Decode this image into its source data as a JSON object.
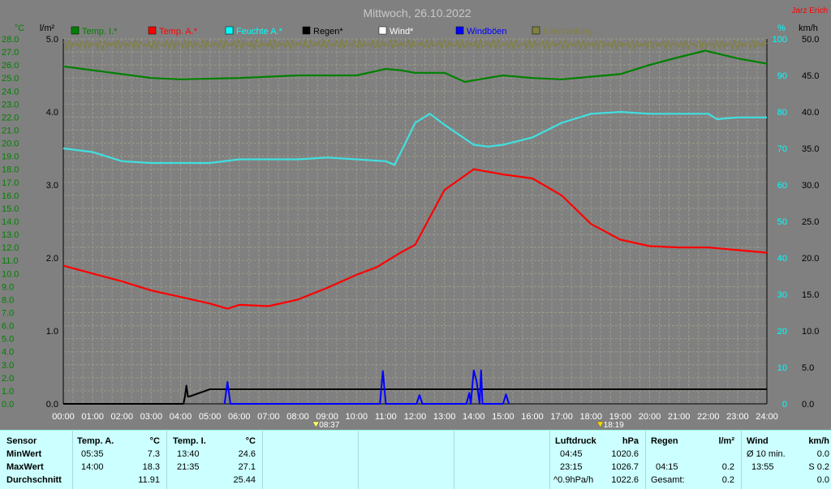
{
  "title": "Mittwoch, 26.10.2022",
  "author": "Jarz Erich",
  "axes": {
    "left_temp_unit": "°C",
    "left_rain_unit": "l/m²",
    "right_hum_unit": "%",
    "right_wind_unit": "km/h",
    "temp_ticks": [
      "28.0",
      "27.0",
      "26.0",
      "25.0",
      "24.0",
      "23.0",
      "22.0",
      "21.0",
      "20.0",
      "19.0",
      "18.0",
      "17.0",
      "16.0",
      "15.0",
      "14.0",
      "13.0",
      "12.0",
      "11.0",
      "10.0",
      "9.0",
      "8.0",
      "7.0",
      "6.0",
      "5.0",
      "4.0",
      "3.0",
      "2.0",
      "1.0",
      "0.0"
    ],
    "rain_ticks": [
      "5.0",
      "4.0",
      "3.0",
      "2.0",
      "1.0",
      "0.0"
    ],
    "hum_ticks": [
      "100",
      "90",
      "80",
      "70",
      "60",
      "50",
      "40",
      "30",
      "20",
      "10",
      "0"
    ],
    "wind_ticks": [
      "50.0",
      "45.0",
      "40.0",
      "35.0",
      "30.0",
      "25.0",
      "20.0",
      "15.0",
      "10.0",
      "5.0",
      "0.0"
    ],
    "time_ticks": [
      "00:00",
      "01:00",
      "02:00",
      "03:00",
      "04:00",
      "05:00",
      "06:00",
      "07:00",
      "08:00",
      "09:00",
      "10:00",
      "11:00",
      "12:00",
      "13:00",
      "14:00",
      "15:00",
      "16:00",
      "17:00",
      "18:00",
      "19:00",
      "20:00",
      "21:00",
      "22:00",
      "23:00",
      "24:00"
    ],
    "sunrise": "08:37",
    "sunset": "18:19"
  },
  "legend": [
    {
      "label": "Temp. I.*",
      "color": "#008000"
    },
    {
      "label": "Temp. A.*",
      "color": "#ff0000"
    },
    {
      "label": "Feuchte A.*",
      "color": "#00ffff"
    },
    {
      "label": "Regen*",
      "color": "#000000"
    },
    {
      "label": "Wind*",
      "color": "#ffffff"
    },
    {
      "label": "Windböen",
      "color": "#0000ff"
    },
    {
      "label": "Einstrahlung",
      "color": "#808040"
    }
  ],
  "colors": {
    "background": "#808080",
    "grid": "#9a9a8a",
    "temp_in": "#008000",
    "temp_out": "#ff0000",
    "humidity": "#40e0e0",
    "rain": "#000000",
    "gust": "#0000ff",
    "radiation": "#808040",
    "temp_axis": "#008000",
    "hum_axis": "#00ffff",
    "wind_axis": "#000000"
  },
  "chart_data": {
    "type": "line",
    "title": "Mittwoch, 26.10.2022",
    "x_unit": "hours",
    "xlim": [
      0,
      24
    ],
    "temp_ylim": [
      0,
      28
    ],
    "rain_ylim": [
      0,
      5
    ],
    "hum_ylim": [
      0,
      100
    ],
    "wind_ylim": [
      0,
      50
    ],
    "series": [
      {
        "name": "Temp. I.*",
        "axis": "temp",
        "color": "#008000",
        "points": [
          [
            0,
            25.9
          ],
          [
            1,
            25.6
          ],
          [
            2,
            25.3
          ],
          [
            3,
            25.0
          ],
          [
            4,
            24.9
          ],
          [
            5,
            24.95
          ],
          [
            6,
            25.0
          ],
          [
            7,
            25.1
          ],
          [
            8,
            25.2
          ],
          [
            9,
            25.2
          ],
          [
            10,
            25.2
          ],
          [
            11,
            25.7
          ],
          [
            11.5,
            25.6
          ],
          [
            12,
            25.4
          ],
          [
            13,
            25.4
          ],
          [
            13.7,
            24.7
          ],
          [
            14.2,
            24.9
          ],
          [
            15,
            25.2
          ],
          [
            16,
            25.0
          ],
          [
            17,
            24.9
          ],
          [
            18,
            25.1
          ],
          [
            19,
            25.3
          ],
          [
            20,
            26.0
          ],
          [
            21,
            26.6
          ],
          [
            21.9,
            27.1
          ],
          [
            23,
            26.5
          ],
          [
            24,
            26.1
          ]
        ]
      },
      {
        "name": "Temp. A.*",
        "axis": "temp",
        "color": "#ff0000",
        "points": [
          [
            0,
            10.6
          ],
          [
            1,
            10.0
          ],
          [
            2,
            9.4
          ],
          [
            3,
            8.7
          ],
          [
            4,
            8.2
          ],
          [
            5,
            7.7
          ],
          [
            5.6,
            7.3
          ],
          [
            6,
            7.6
          ],
          [
            7,
            7.5
          ],
          [
            8,
            8.0
          ],
          [
            9,
            8.9
          ],
          [
            10,
            9.9
          ],
          [
            10.7,
            10.5
          ],
          [
            11.5,
            11.6
          ],
          [
            12,
            12.2
          ],
          [
            13,
            16.4
          ],
          [
            14,
            18.0
          ],
          [
            15,
            17.6
          ],
          [
            16,
            17.3
          ],
          [
            17,
            16.0
          ],
          [
            18,
            13.8
          ],
          [
            19,
            12.6
          ],
          [
            20,
            12.1
          ],
          [
            21,
            12.0
          ],
          [
            22,
            12.0
          ],
          [
            23,
            11.8
          ],
          [
            24,
            11.6
          ]
        ]
      },
      {
        "name": "Feuchte A.*",
        "axis": "hum",
        "color": "#40e0e0",
        "points": [
          [
            0,
            70.0
          ],
          [
            1,
            69.0
          ],
          [
            2,
            66.5
          ],
          [
            3,
            66.0
          ],
          [
            4,
            66.0
          ],
          [
            5,
            66.0
          ],
          [
            6,
            67.0
          ],
          [
            7,
            67.0
          ],
          [
            8,
            67.0
          ],
          [
            9,
            67.5
          ],
          [
            10,
            67.0
          ],
          [
            11,
            66.5
          ],
          [
            11.3,
            65.5
          ],
          [
            11.7,
            72.0
          ],
          [
            12,
            77.0
          ],
          [
            12.5,
            79.5
          ],
          [
            13,
            76.5
          ],
          [
            14,
            71.0
          ],
          [
            14.5,
            70.5
          ],
          [
            15,
            71.0
          ],
          [
            16,
            73.0
          ],
          [
            17,
            77.0
          ],
          [
            18,
            79.5
          ],
          [
            19,
            80.0
          ],
          [
            20,
            79.5
          ],
          [
            21,
            79.5
          ],
          [
            22,
            79.5
          ],
          [
            22.3,
            78.0
          ],
          [
            23,
            78.5
          ],
          [
            24,
            78.5
          ]
        ]
      },
      {
        "name": "Regen*",
        "axis": "rain",
        "color": "#000000",
        "points": [
          [
            0,
            0
          ],
          [
            4.1,
            0
          ],
          [
            4.15,
            0.1
          ],
          [
            4.2,
            0.25
          ],
          [
            4.25,
            0.1
          ],
          [
            4.3,
            0.1
          ],
          [
            5,
            0.2
          ],
          [
            6,
            0.2
          ],
          [
            24,
            0.2
          ]
        ]
      },
      {
        "name": "Windböen",
        "axis": "wind",
        "color": "#0000ff",
        "points": [
          [
            5.5,
            0
          ],
          [
            5.6,
            3.0
          ],
          [
            5.7,
            0
          ],
          [
            10.8,
            0
          ],
          [
            10.9,
            4.5
          ],
          [
            11.0,
            0
          ],
          [
            12.05,
            0
          ],
          [
            12.15,
            1.2
          ],
          [
            12.25,
            0
          ],
          [
            13.75,
            0
          ],
          [
            13.85,
            1.5
          ],
          [
            13.9,
            0
          ],
          [
            14.0,
            4.6
          ],
          [
            14.1,
            3.0
          ],
          [
            14.2,
            0
          ],
          [
            14.25,
            4.6
          ],
          [
            14.3,
            0
          ],
          [
            15.0,
            0
          ],
          [
            15.1,
            1.3
          ],
          [
            15.2,
            0
          ]
        ]
      },
      {
        "name": "Einstrahlung",
        "axis": "hum",
        "color": "#808040",
        "points": [
          [
            0,
            98.5
          ],
          [
            24,
            98.5
          ]
        ]
      }
    ]
  },
  "panel": {
    "sensor": {
      "title": "Sensor",
      "min": "MinWert",
      "max": "MaxWert",
      "avg": "Durchschnitt"
    },
    "temp_a": {
      "title": "Temp. A.",
      "unit": "°C",
      "min_time": "05:35",
      "min_val": "7.3",
      "max_time": "14:00",
      "max_val": "18.3",
      "avg_val": "11.91"
    },
    "temp_i": {
      "title": "Temp. I.",
      "unit": "°C",
      "min_time": "13:40",
      "min_val": "24.6",
      "max_time": "21:35",
      "max_val": "27.1",
      "avg_val": "25.44"
    },
    "luft": {
      "title": "Luftdruck",
      "unit": "hPa",
      "min_time": "04:45",
      "min_val": "1020.6",
      "max_time": "23:15",
      "max_val": "1026.7",
      "trend_time": "^0.9hPa/h",
      "trend_val": "1022.6"
    },
    "regen": {
      "title": "Regen",
      "unit": "l/m²",
      "r1_time": "04:15",
      "r1_val": "0.2",
      "r2_time": "Gesamt:",
      "r2_val": "0.2"
    },
    "wind": {
      "title": "Wind",
      "unit": "km/h",
      "r1_time": "Ø 10 min.",
      "r1_val": "0.0",
      "r2_time": "13:55",
      "r2_val": "S 0.2",
      "r3_val": "0.0"
    }
  }
}
